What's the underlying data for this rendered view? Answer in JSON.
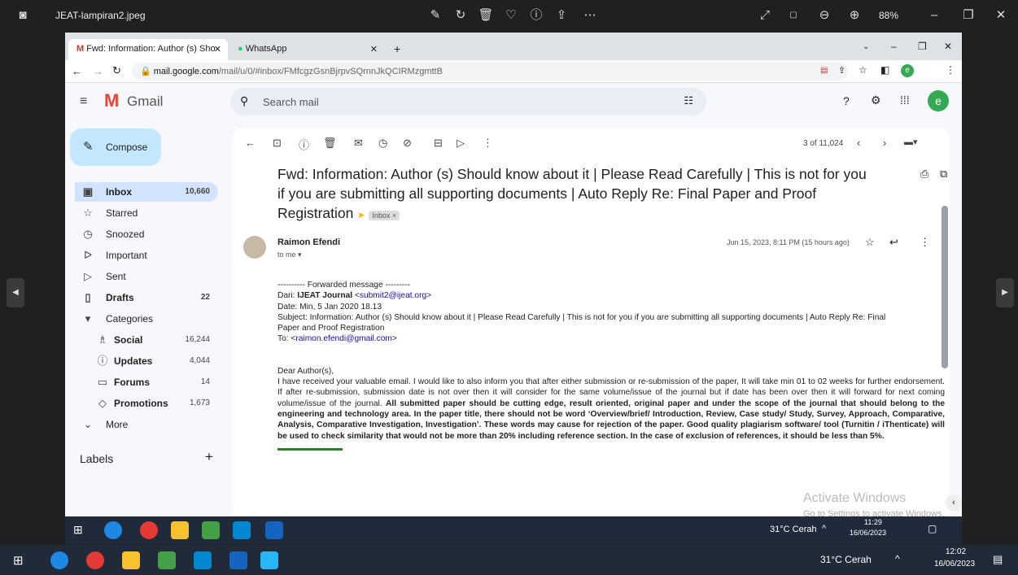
{
  "viewer": {
    "filename": "JEAT-lampiran2.jpeg",
    "zoom": "88%"
  },
  "browser": {
    "tab1": "Fwd: Information: Author (s) Sho",
    "tab2": "WhatsApp",
    "url_domain": "mail.google.com",
    "url_path": "/mail/u/0/#inbox/FMfcgzGsnBjrpvSQrnnJkQCIRMzgmttB",
    "avatar_letter": "e"
  },
  "gmail": {
    "brand": "Gmail",
    "search_placeholder": "Search mail",
    "compose": "Compose",
    "nav": [
      {
        "label": "Inbox",
        "count": "10,660"
      },
      {
        "label": "Starred",
        "count": ""
      },
      {
        "label": "Snoozed",
        "count": ""
      },
      {
        "label": "Important",
        "count": ""
      },
      {
        "label": "Sent",
        "count": ""
      },
      {
        "label": "Drafts",
        "count": "22"
      },
      {
        "label": "Categories",
        "count": ""
      }
    ],
    "categories": [
      {
        "label": "Social",
        "count": "16,244"
      },
      {
        "label": "Updates",
        "count": "4,044"
      },
      {
        "label": "Forums",
        "count": "14"
      },
      {
        "label": "Promotions",
        "count": "1,673"
      }
    ],
    "more": "More",
    "labels": "Labels",
    "labels_add": "+",
    "pagination": "3 of 11,024"
  },
  "email": {
    "subject_line1": "Fwd: Information: Author (s) Should know about it | Please Read Carefully | This is not for you",
    "subject_line2": "if you are submitting all supporting documents | Auto Reply Re: Final Paper and Proof",
    "subject_line3": "Registration",
    "inbox_tag": "Inbox ×",
    "sender": "Raimon Efendi",
    "to": "to me ▾",
    "date": "Jun 15, 2023, 8:11 PM (15 hours ago)",
    "fwd_header": "---------- Forwarded message ---------",
    "from_label": "Dari: ",
    "from_name": "IJEAT Journal",
    "from_lt": " <",
    "from_email": "submit2@ijeat.org",
    "from_gt": ">",
    "date_line": "Date: Min, 5 Jan 2020 18.13",
    "subject_fwd1": "Subject: Information: Author (s) Should know about it | Please Read Carefully | This is not for you if you are submitting all supporting documents | Auto Reply Re: Final",
    "subject_fwd2": "Paper and Proof Registration",
    "to_label": "To: <",
    "to_email": "raimon.efendi@gmail.com",
    "to_gt": ">",
    "greeting": "Dear Author(s),",
    "para_plain": "I have received your valuable email. I would like to also inform you that after either submission or re-submission of the paper, It will take min 01 to 02 weeks for further endorsement. If after re-submission, submission date is not over then it will consider for the same volume/issue of the journal but if date has been over then it will forward for next coming volume/issue of the journal. ",
    "para_bold": "All submitted paper should be cutting edge, result oriented, original paper and under the scope of the journal that should belong to the engineering and technology area. In the paper title, there should not be word ‘Overview/brief/ Introduction, Review, Case study/ Study, Survey, Approach, Comparative, Analysis, Comparative Investigation, Investigation’. These words may cause for rejection of the paper. Good quality plagiarism software/ tool (Turnitin / iThenticate) will be used to check similarity that would not be more than 20% including reference section. In the case of exclusion of references, it should be less than 5%."
  },
  "activate": {
    "title": "Activate Windows",
    "sub": "Go to Settings to activate Windows."
  },
  "taskbar_inner": {
    "weather": "31°C Cerah",
    "time": "11:29",
    "date": "16/06/2023"
  },
  "taskbar_outer": {
    "weather": "31°C Cerah",
    "time": "12:02",
    "date": "16/06/2023"
  },
  "colors": {
    "gmail_bg": "#f6f8fc",
    "inbox_highlight": "#d3e3fd",
    "compose_bg": "#c2e7ff",
    "link": "#1a0dab"
  }
}
